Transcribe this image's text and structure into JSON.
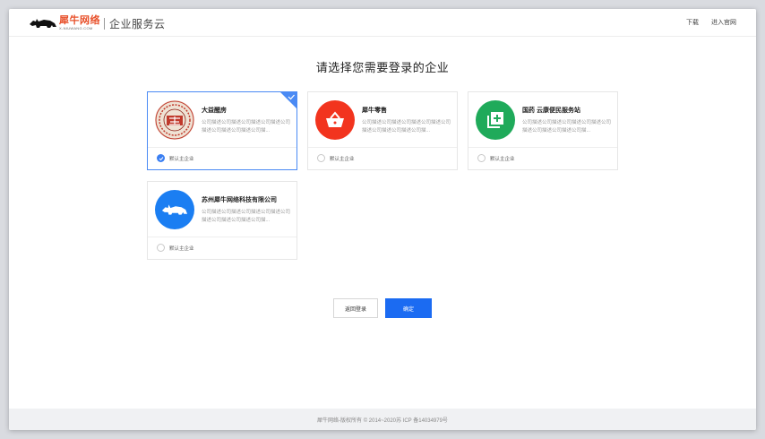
{
  "header": {
    "brand_cn": "犀牛网络",
    "brand_en": "X-NIUWANG.COM",
    "subtitle": "企业服务云",
    "links": [
      "下载",
      "进入官网"
    ]
  },
  "page": {
    "title": "请选择您需要登录的企业"
  },
  "companies": [
    {
      "name": "大益醒房",
      "desc": "公司描述公司描述公司描述公司描述公司描述公司描述公司描述公司描...",
      "radio_label": "默认主企业",
      "selected": true,
      "logo_icon": "dayi-seal-icon",
      "logo_color": "#c0392b"
    },
    {
      "name": "犀牛零售",
      "desc": "公司描述公司描述公司描述公司描述公司描述公司描述公司描述公司描...",
      "radio_label": "默认主企业",
      "selected": false,
      "logo_icon": "shopping-basket-icon",
      "logo_color": "#f2341e"
    },
    {
      "name": "国药 云康便民服务站",
      "desc": "公司描述公司描述公司描述公司描述公司描述公司描述公司描述公司描...",
      "radio_label": "默认主企业",
      "selected": false,
      "logo_icon": "add-square-icon",
      "logo_color": "#1faa5a"
    },
    {
      "name": "苏州犀牛网络科技有限公司",
      "desc": "公司描述公司描述公司描述公司描述公司描述公司描述公司描述公司描...",
      "radio_label": "默认主企业",
      "selected": false,
      "logo_icon": "rhino-icon",
      "logo_color": "#1b7ef2"
    }
  ],
  "actions": {
    "back_label": "返回登录",
    "confirm_label": "确定"
  },
  "footer": {
    "text": "犀牛网络-版权所有 © 2014~2020苏 ICP 备14034979号"
  },
  "colors": {
    "accent": "#1b6bf2",
    "selected_border": "#4a8af4"
  }
}
